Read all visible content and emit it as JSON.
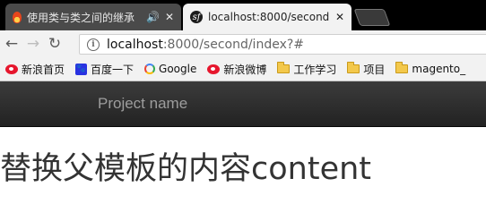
{
  "tabs": [
    {
      "title": "使用类与类之间的继承",
      "favicon": "fire-icon",
      "audio": "🔊",
      "close": "✕"
    },
    {
      "title": "localhost:8000/second",
      "favicon": "symfony-icon",
      "close": "✕"
    }
  ],
  "toolbar": {
    "back": "←",
    "forward": "→",
    "reload": "↻",
    "info": "i",
    "url_host": "localhost",
    "url_path": ":8000/second/index?#"
  },
  "bookmarks": [
    {
      "label": "新浪首页",
      "icon": "weibo-icon"
    },
    {
      "label": "百度一下",
      "icon": "baidu-icon"
    },
    {
      "label": "Google",
      "icon": "google-icon"
    },
    {
      "label": "新浪微博",
      "icon": "weibo-icon"
    },
    {
      "label": "工作学习",
      "icon": "folder-icon"
    },
    {
      "label": "项目",
      "icon": "folder-icon"
    },
    {
      "label": "magento_",
      "icon": "folder-icon"
    }
  ],
  "page": {
    "brand": "Project name",
    "content": "替换父模板的内容content"
  },
  "colors": {
    "navbar": "#222222",
    "brand_text": "#9d9d9d",
    "tabstrip": "#000000"
  }
}
